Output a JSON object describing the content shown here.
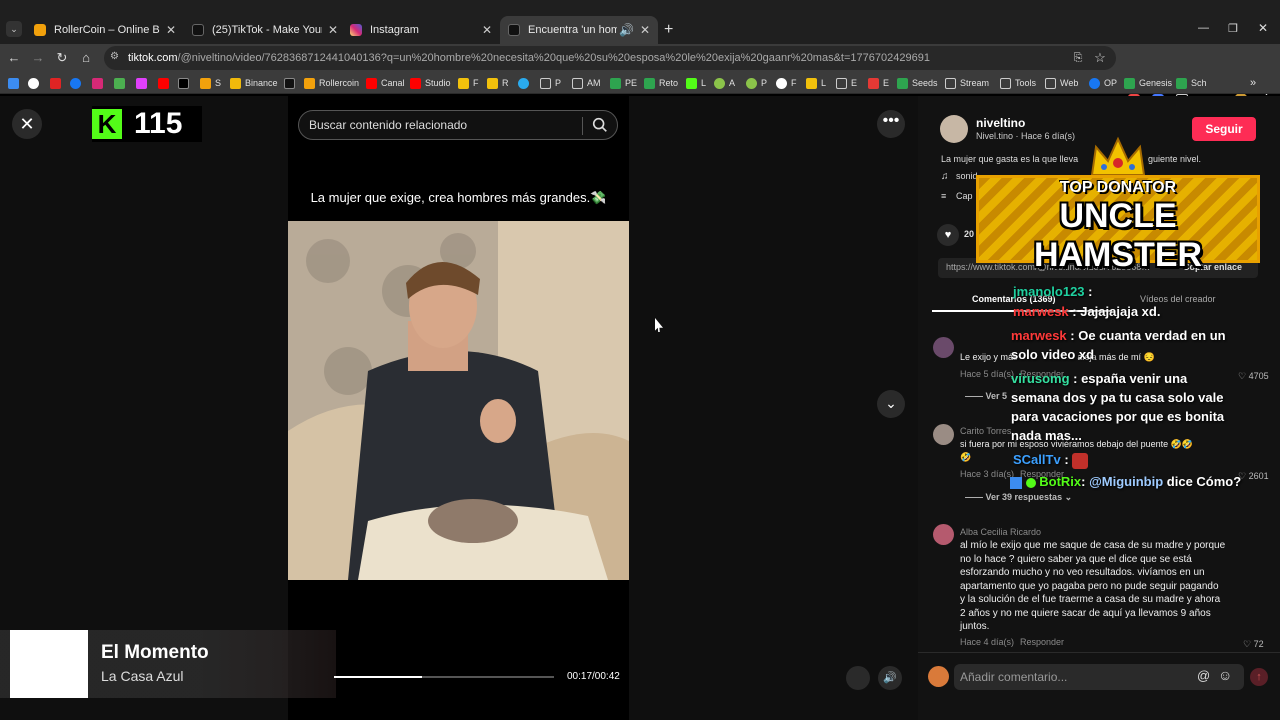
{
  "tabs": [
    {
      "title": "RollerCoin – Online Bitcoin Mi…",
      "favicon_color": "#f2a10c"
    },
    {
      "title": "(25)TikTok - Make Your Day",
      "favicon_color": "#111111"
    },
    {
      "title": "Instagram",
      "favicon_color": "#d62976"
    },
    {
      "title": "Encuentra 'un hombre nece…",
      "favicon_color": "#111111"
    }
  ],
  "address": {
    "host": "tiktok.com",
    "path": "/@niveltino/video/7628368712441040136?q=un%20hombre%20necesita%20que%20su%20esposa%20le%20exija%20gaanr%20mas&t=1776702429691"
  },
  "bookmarks": [
    "S",
    "Binance",
    "Rollercoin",
    "Canal",
    "Studio",
    "F",
    "R",
    "P",
    "AM",
    "PE",
    "Reto",
    "L",
    "A",
    "P",
    "F",
    "L",
    "E",
    "E",
    "Seeds",
    "Stream",
    "Tools",
    "Web",
    "OP",
    "Genesis",
    "Sch"
  ],
  "kick": {
    "count": "115"
  },
  "search": {
    "placeholder": "Buscar contenido relacionado"
  },
  "video": {
    "caption": "La mujer que exige, crea hombres más grandes.💸",
    "time": "00:17/00:42",
    "progress": 0.4
  },
  "now_playing": {
    "title": "El Momento",
    "artist": "La Casa Azul"
  },
  "creator": {
    "name": "niveltino",
    "sub": "Nivel.tino · Hace 6 día(s)",
    "follow": "Seguir",
    "desc": "La mujer que gasta es la que lleva",
    "desc_end": "guiente nivel.",
    "sound": "sonid",
    "cap": "Cap",
    "likes": "20",
    "link": "https://www.tiktok.com/@niveltino/video/7628368…",
    "copy": "Copiar enlace"
  },
  "panel_tabs": {
    "comments": "Comentarios (1369)",
    "videos": "Vídeos del creador"
  },
  "comments": [
    {
      "text": "Le exijo y más",
      "text2": "aleja más de mí 😔",
      "meta": "Hace 5 día(s)",
      "reply": "Responder",
      "likes": "4705",
      "more": "Ver 5"
    },
    {
      "name": "Carito Torres",
      "text": "si fuera por mi esposo viviéramos debajo del puente 🤣🤣",
      "text2": "🤣",
      "meta": "Hace 3 día(s)",
      "reply": "Responder",
      "likes": "2601",
      "more": "Ver 39 respuestas"
    },
    {
      "name": "Alba Cecilia Ricardo",
      "lines": [
        "al mío le exijo que me saque de casa de su madre y porque",
        "no lo hace ? quiero saber ya que el dice que se está",
        "esforzando mucho y no veo resultados. vivíamos en un",
        "apartamento que yo pagaba pero no pude seguir pagando",
        "y la solución de el fue traerme a casa de su madre y ahora",
        "2 años y no me quiere sacar de aquí ya llevamos 9 años",
        "juntos."
      ],
      "meta": "Hace 4 día(s)",
      "reply": "Responder",
      "likes": "72"
    }
  ],
  "comment_input": {
    "placeholder": "Añadir comentario..."
  },
  "donator": {
    "line1": "TOP DONATOR",
    "line2": "UNCLE HAMSTER"
  },
  "chat": [
    {
      "user": "jmanolo123",
      "msg": ":",
      "color": "#1fd1a0"
    },
    {
      "user": "marwesk",
      "msg": ": Jajajajaja xd.",
      "color": "#ff3a3a"
    },
    {
      "user": "marwesk",
      "msg": ": Oe cuanta verdad en un solo video xd",
      "color": "#ff3a3a"
    },
    {
      "user": "virusomg",
      "msg": ": españa venir una semana dos y pa tu casa solo vale para vacaciones por que es bonita nada mas...",
      "color": "#35e0a0"
    },
    {
      "user": "SCallTv",
      "msg": ":",
      "color": "#3ca0ff"
    },
    {
      "user": "BotRix",
      "msg": ":",
      "mention": "@Miguinbip",
      "tail": "dice Cómo?",
      "color": "#53fc18"
    }
  ]
}
